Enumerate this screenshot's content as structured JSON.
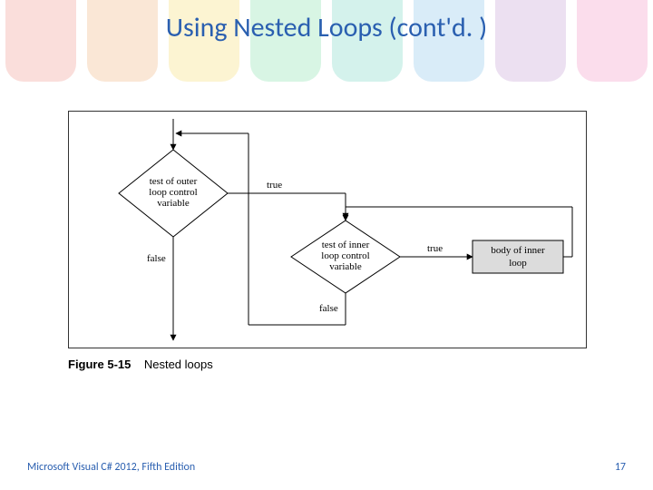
{
  "title": "Using Nested Loops (cont'd. )",
  "figure": {
    "number": "Figure 5-15",
    "caption": "Nested loops",
    "outer_diamond": [
      "test of outer",
      "loop control",
      "variable"
    ],
    "inner_diamond": [
      "test of inner",
      "loop control",
      "variable"
    ],
    "body_box": [
      "body of inner",
      "loop"
    ],
    "label_true_outer": "true",
    "label_false_outer": "false",
    "label_true_inner": "true",
    "label_false_inner": "false"
  },
  "footer": {
    "left": "Microsoft Visual C# 2012, Fifth Edition",
    "right": "17"
  },
  "colors": {
    "accent": "#2a5fb0",
    "rainbow": [
      "#e74c3c",
      "#e67e22",
      "#f1c40f",
      "#2ecc71",
      "#1abc9c",
      "#3498db",
      "#9b59b6",
      "#e84393"
    ]
  }
}
